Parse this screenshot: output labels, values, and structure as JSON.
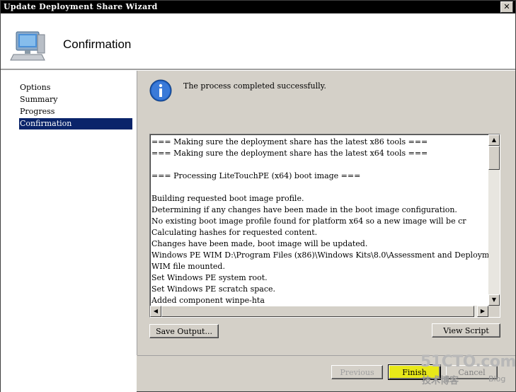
{
  "window": {
    "title": "Update Deployment Share Wizard",
    "close_glyph": "✕"
  },
  "header": {
    "title": "Confirmation",
    "icon": "computer-icon"
  },
  "sidebar": {
    "items": [
      {
        "label": "Options",
        "active": false
      },
      {
        "label": "Summary",
        "active": false
      },
      {
        "label": "Progress",
        "active": false
      },
      {
        "label": "Confirmation",
        "active": true
      }
    ]
  },
  "status": {
    "icon": "info-icon",
    "message": "The process completed successfully."
  },
  "log": {
    "lines": [
      "=== Making sure the deployment share has the latest x86 tools ===",
      "=== Making sure the deployment share has the latest x64 tools ===",
      "",
      "=== Processing LiteTouchPE (x64) boot image ===",
      "",
      "Building requested boot image profile.",
      "Determining if any changes have been made in the boot image configuration.",
      "No existing boot image profile found for platform x64 so a new image will be cr",
      "Calculating hashes for requested content.",
      "Changes have been made, boot image will be updated.",
      "Windows PE WIM D:\\Program Files (x86)\\Windows Kits\\8.0\\Assessment and Deploymen",
      "WIM file mounted.",
      "Set Windows PE system root.",
      "Set Windows PE scratch space.",
      "Added component winpe-hta"
    ]
  },
  "buttons": {
    "save_output": "Save Output...",
    "view_script": "View Script",
    "previous": "Previous",
    "finish": "Finish",
    "cancel": "Cancel"
  },
  "watermark": {
    "main": "51CTO.com",
    "sub": "技术博客",
    "blog": "Blog"
  },
  "colors": {
    "selection": "#0a246a",
    "focus_button": "#e8e818",
    "info_icon": "#1f5fbf"
  }
}
